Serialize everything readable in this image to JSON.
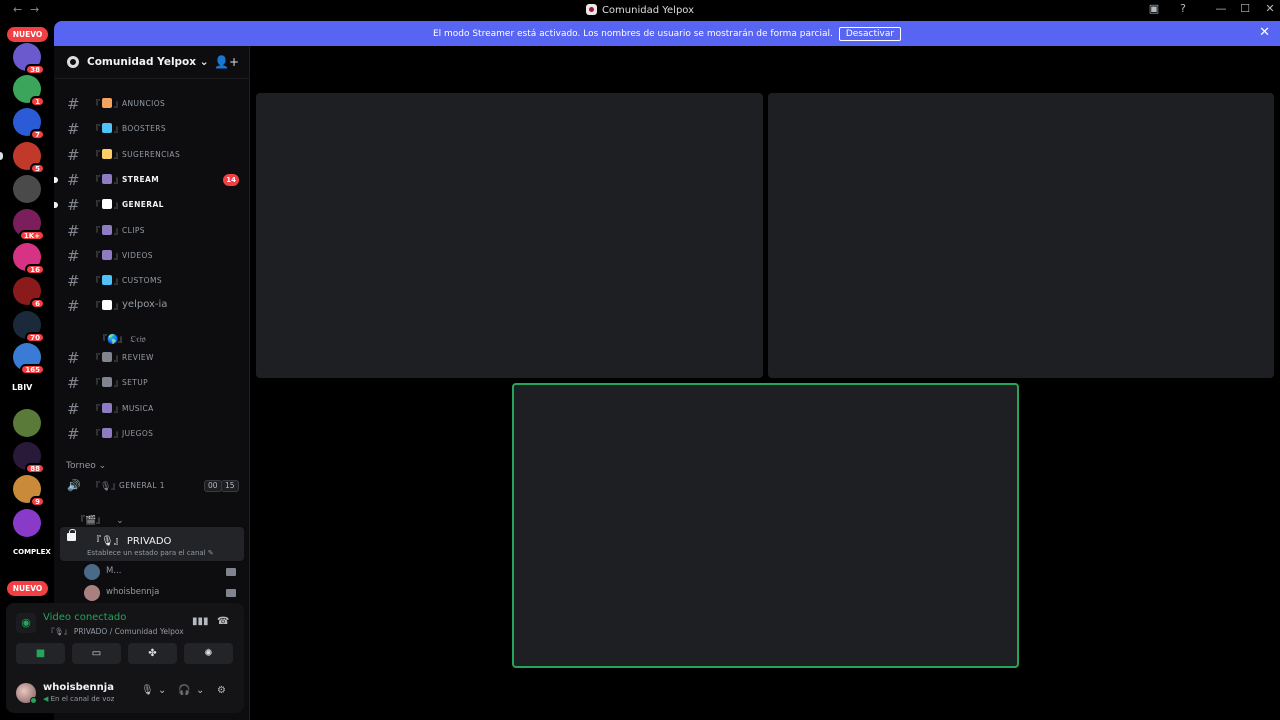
{
  "window": {
    "title": "Comunidad Yelpox",
    "nav_back": "←",
    "nav_forward": "→",
    "controls": [
      "▣",
      "?",
      "—",
      "☐",
      "✕"
    ]
  },
  "banner": {
    "message": "El modo Streamer está activado. Los nombres de usuario se mostrarán de forma parcial.",
    "button": "Desactivar",
    "close": "✕",
    "color": "#5865f2"
  },
  "rail": {
    "nuevo_top": "NUEVO",
    "nuevo_bottom": "NUEVO",
    "servers": [
      {
        "badge": "38",
        "color": "#6a5acd"
      },
      {
        "badge": "1",
        "color": "#3ba55c"
      },
      {
        "badge": "7",
        "color": "#2b5bd7"
      },
      {
        "badge": "5",
        "color": "#c0392b"
      },
      {
        "badge": "",
        "color": "#4a4a4a"
      },
      {
        "badge": "1K+",
        "color": "#7a1f5c"
      },
      {
        "badge": "16",
        "color": "#d63384"
      },
      {
        "badge": "6",
        "color": "#8b1a1a"
      },
      {
        "badge": "70",
        "color": "#1a2a3a"
      },
      {
        "badge": "165",
        "color": "#3a7bd5"
      },
      {
        "badge": "",
        "color": "#000000"
      },
      {
        "badge": "",
        "color": "#5a7a3a"
      },
      {
        "badge": "88",
        "color": "#2a1a3a"
      },
      {
        "badge": "9",
        "color": "#c98a3a"
      },
      {
        "badge": "",
        "color": "#8a3ac9"
      },
      {
        "badge": "236",
        "color": "#000000"
      }
    ],
    "text_server_1": "LBIV",
    "text_server_2": "COMPLEX"
  },
  "sidebar": {
    "server_name": "Comunidad Yelpox",
    "server_chevron": "⌄",
    "invite_icon": "👤+",
    "channels": [
      {
        "name": "ANUNCIOS",
        "prefix": "『",
        "suffix": "』",
        "emoji_color": "#f4a460"
      },
      {
        "name": "BOOSTERS",
        "prefix": "『",
        "suffix": "』",
        "emoji_color": "#4fc3f7"
      },
      {
        "name": "SUGERENCIAS",
        "prefix": "『",
        "suffix": "』",
        "emoji_color": "#ffcc66"
      },
      {
        "name": "STREAM",
        "prefix": "『",
        "suffix": "』",
        "emoji_color": "#8e7cc3",
        "mention": "14"
      },
      {
        "name": "GENERAL",
        "prefix": "『",
        "suffix": "』",
        "emoji_color": "#ffffff"
      },
      {
        "name": "CLIPS",
        "prefix": "『",
        "suffix": "』",
        "emoji_color": "#8e7cc3"
      },
      {
        "name": "VIDEOS",
        "prefix": "『",
        "suffix": "』",
        "emoji_color": "#8e7cc3"
      },
      {
        "name": "CUSTOMS",
        "prefix": "『",
        "suffix": "』",
        "emoji_color": "#4fc3f7"
      },
      {
        "name": "yelpox-ia",
        "prefix": "『",
        "suffix": "』",
        "emoji_color": "#ffffff"
      }
    ],
    "category_ocio": "『🌎』 𝔒𝔠𝔦𝔬",
    "ocio_channels": [
      {
        "name": "REVIEW",
        "prefix": "『",
        "suffix": "』",
        "emoji_color": "#80848e"
      },
      {
        "name": "SETUP",
        "prefix": "『",
        "suffix": "』",
        "emoji_color": "#80848e"
      },
      {
        "name": "MUSICA",
        "prefix": "『",
        "suffix": "』",
        "emoji_color": "#8e7cc3"
      },
      {
        "name": "JUEGOS",
        "prefix": "『",
        "suffix": "』",
        "emoji_color": "#8e7cc3"
      }
    ],
    "category_torneo": "Torneo",
    "torneo_channel": {
      "name": "GENERAL 1",
      "icon": "『🎙』",
      "count_a": "00",
      "count_b": "15"
    },
    "category_private": "『🎬』",
    "privado": {
      "name": "PRIVADO",
      "icon": "『🎙』",
      "status": "Establece un estado para el canal ✎"
    },
    "voice_users": [
      {
        "name": "M...",
        "color": "#4a6a8a"
      },
      {
        "name": "whoisbennja",
        "color": "#a88080"
      }
    ]
  },
  "voice_panel": {
    "state": "Video conectado",
    "location": "『🎙』 PRIVADO / Comunidad Yelpox",
    "buttons": [
      "camera-button",
      "screenshare-button",
      "activities-button",
      "soundboard-button"
    ],
    "accent": "#23a55a"
  },
  "user_panel": {
    "username": "whoisbennja",
    "status": "En el canal de voz"
  },
  "stage": {
    "tiles": [
      "tile-1",
      "tile-2",
      "tile-3"
    ],
    "speaking_color": "#23a55a"
  }
}
